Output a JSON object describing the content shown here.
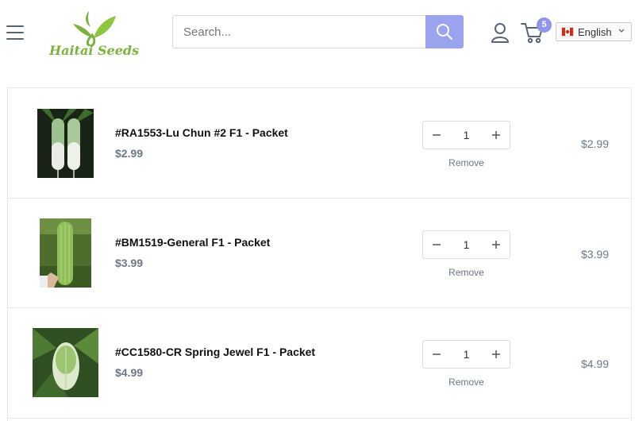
{
  "header": {
    "logo_text": "Haitai Seeds",
    "search": {
      "placeholder": "Search..."
    },
    "cart_count": "5",
    "language": "English",
    "icons": [
      "menu-icon",
      "search-icon",
      "account-icon",
      "cart-icon",
      "canada-flag-icon",
      "chevron-down-icon"
    ]
  },
  "colors": {
    "accent": "#9aa3ee",
    "badge": "#8d96e8",
    "logo_green": "#7cb33e",
    "price_gray": "#6b7886"
  },
  "items": [
    {
      "title": "#RA1553-Lu Chun #2 F1 - Packet",
      "price": "$2.99",
      "quantity": "1",
      "remove_label": "Remove",
      "line_total": "$2.99"
    },
    {
      "title": "#BM1519-General F1 - Packet",
      "price": "$3.99",
      "quantity": "1",
      "remove_label": "Remove",
      "line_total": "$3.99"
    },
    {
      "title": "#CC1580-CR Spring Jewel F1 - Packet",
      "price": "$4.99",
      "quantity": "1",
      "remove_label": "Remove",
      "line_total": "$4.99"
    }
  ]
}
